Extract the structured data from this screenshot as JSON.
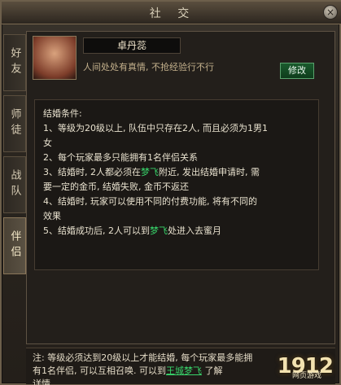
{
  "window": {
    "title": "社 交",
    "close_glyph": "×"
  },
  "tabs": [
    {
      "label": "好友"
    },
    {
      "label": "师徒"
    },
    {
      "label": "战队"
    },
    {
      "label": "伴侣"
    }
  ],
  "profile": {
    "name": "卓丹蕊",
    "motto": "人间处处有真情, 不抢经验行不行",
    "edit_label": "修改"
  },
  "content": {
    "lines": [
      "结婚条件:",
      "1、等级为20级以上, 队伍中只存在2人, 而且必须为1男1",
      "女",
      "2、每个玩家最多只能拥有1名伴侣关系",
      "3、结婚时, 2人都必须在梦飞附近, 发出结婚申请时, 需",
      "要一定的金币, 结婚失败, 金币不返还",
      "4、结婚时, 玩家可以使用不同的付费功能, 将有不同的",
      "效果",
      "5、结婚成功后, 2人可以到梦飞处进入去蜜月"
    ]
  },
  "footer": {
    "text1": "注: 等级必须达到20级以上才能结婚, 每个玩家最多能拥",
    "text2": "有1名伴侣, 可以互相召唤. 可以到王城梦飞",
    "text3": "了解",
    "text4": "详情"
  },
  "logo": {
    "text": "1912",
    "sub": "网页游戏"
  }
}
